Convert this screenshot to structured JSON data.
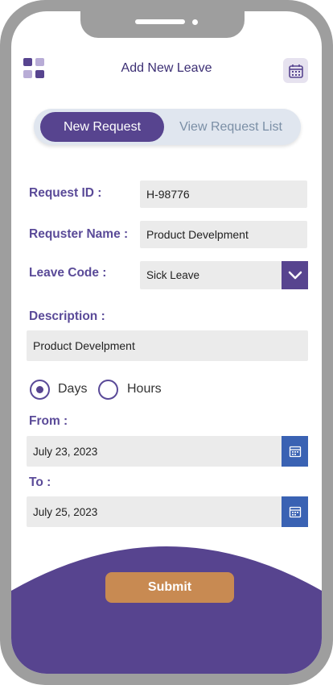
{
  "header": {
    "title": "Add New Leave",
    "apps_icon": "apps-grid-icon",
    "calendar_icon": "calendar-icon"
  },
  "tabs": {
    "active_label": "New Request",
    "inactive_label": "View Request List"
  },
  "form": {
    "request_id_label": "Request ID :",
    "request_id_value": "H-98776",
    "requester_name_label": "Requster Name :",
    "requester_name_value": "Product Develpment",
    "leave_code_label": "Leave Code :",
    "leave_code_value": "Sick Leave",
    "description_label": "Description :",
    "description_value": "Product Develpment",
    "duration_options": [
      "Days",
      "Hours"
    ],
    "duration_selected": "Days",
    "from_label": "From :",
    "from_value": "July 23, 2023",
    "to_label": "To :",
    "to_value": "July 25, 2023"
  },
  "actions": {
    "submit_label": "Submit"
  },
  "colors": {
    "primary": "#57448f",
    "accent": "#c88a52",
    "date_button": "#3a62b3",
    "field_bg": "#ebebeb"
  }
}
